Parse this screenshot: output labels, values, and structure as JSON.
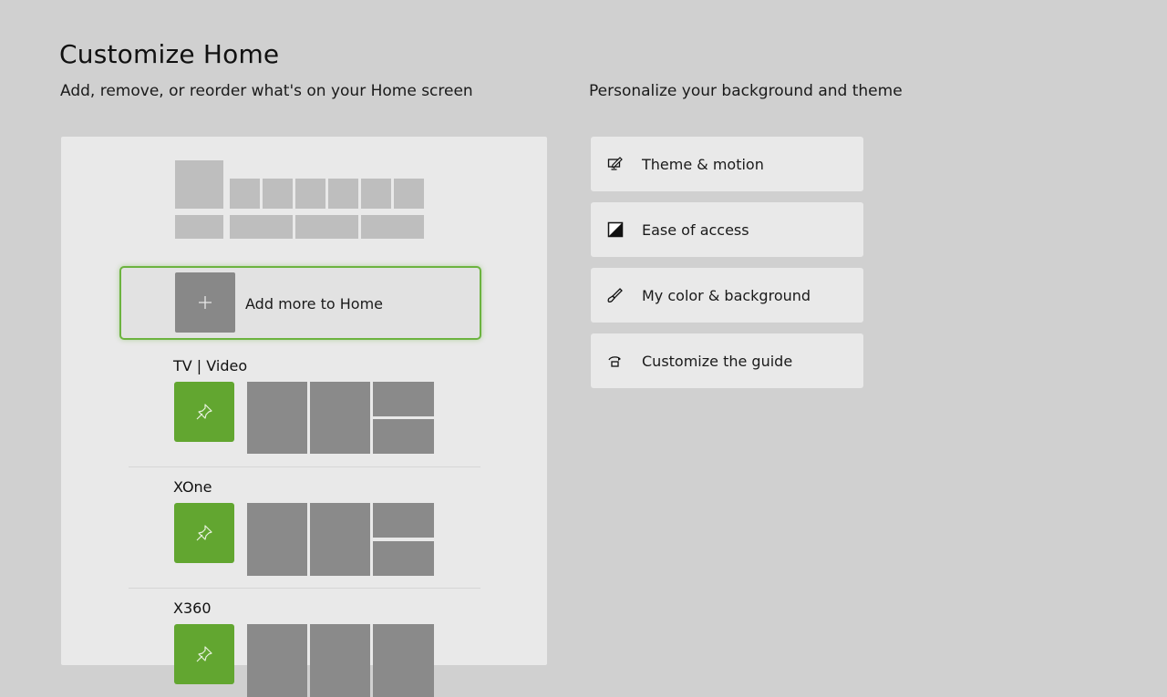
{
  "header": {
    "title": "Customize Home",
    "subtitle_left": "Add, remove, or reorder what's on your Home screen",
    "subtitle_right": "Personalize your background and theme"
  },
  "home_panel": {
    "add_more": {
      "label": "Add more to Home",
      "icon": "plus-icon",
      "focused": true
    },
    "groups": [
      {
        "label": "TV | Video",
        "pin_icon": "pin-icon"
      },
      {
        "label": "XOne",
        "pin_icon": "pin-icon"
      },
      {
        "label": "X360",
        "pin_icon": "pin-icon"
      }
    ]
  },
  "personalize_menu": {
    "items": [
      {
        "label": "Theme & motion",
        "icon": "monitor-pen-icon"
      },
      {
        "label": "Ease of access",
        "icon": "contrast-icon"
      },
      {
        "label": "My color & background",
        "icon": "paintbrush-icon"
      },
      {
        "label": "Customize the guide",
        "icon": "guide-icon"
      }
    ]
  },
  "colors": {
    "accent_green": "#62a630",
    "focus_border": "#6cb33f",
    "background": "#d0d0d0",
    "panel": "#e9e9e9"
  }
}
